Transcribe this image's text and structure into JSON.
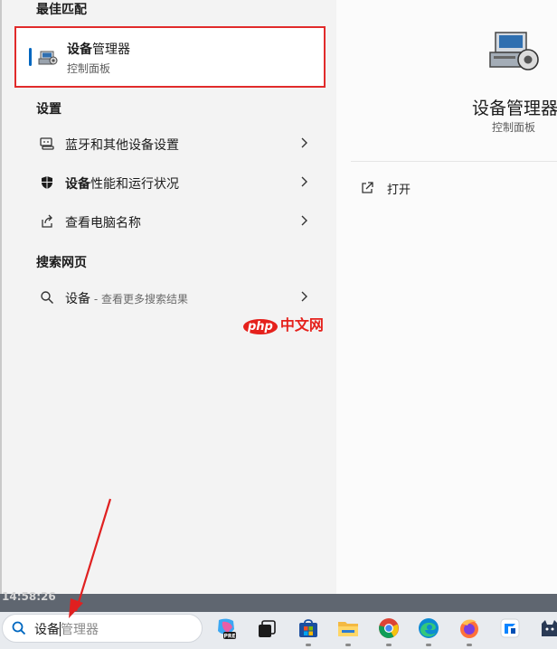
{
  "best_match": {
    "section_title": "最佳匹配",
    "title_bold": "设备",
    "title_rest": "管理器",
    "subtitle": "控制面板",
    "icon": "device-manager-icon"
  },
  "settings": {
    "section_title": "设置",
    "items": [
      {
        "label_bold": "",
        "label": "蓝牙和其他设备设置",
        "icon": "bluetooth-devices-icon"
      },
      {
        "label_bold": "设备",
        "label": "性能和运行状况",
        "icon": "shield-icon"
      },
      {
        "label_bold": "",
        "label": "查看电脑名称",
        "icon": "share-icon"
      }
    ]
  },
  "web": {
    "section_title": "搜索网页",
    "item_label": "设备",
    "item_sub": " - 查看更多搜索结果",
    "icon": "search-icon"
  },
  "watermark": {
    "pill": "php",
    "text": "中文网"
  },
  "detail": {
    "title": "设备管理器",
    "subtitle": "控制面板",
    "open_label": "打开"
  },
  "desktop": {
    "clock": "14:58:26"
  },
  "taskbar": {
    "search_typed": "设备",
    "search_suggest": "管理器",
    "apps": [
      "copilot-pre-icon",
      "task-view-icon",
      "microsoft-store-icon",
      "file-explorer-icon",
      "chrome-icon",
      "edge-icon",
      "firefox-icon",
      "app-icon",
      "cat-app-icon"
    ]
  },
  "colors": {
    "accent": "#0067c0",
    "highlight": "#e12b2b"
  }
}
